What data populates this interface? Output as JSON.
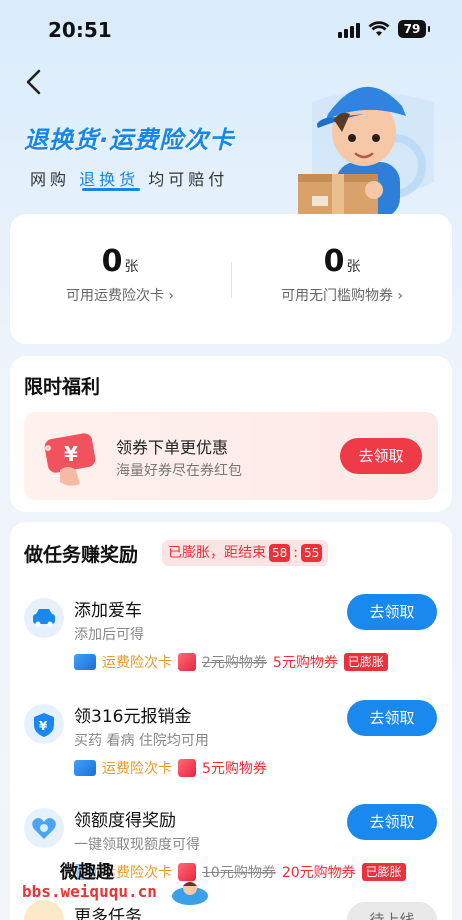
{
  "status_bar": {
    "time": "20:51",
    "battery": "79"
  },
  "hero": {
    "title": "退换货·运费险次卡",
    "subtitle_pre": "网购",
    "subtitle_hl": "退换货",
    "subtitle_post": "均可赔付"
  },
  "stats": [
    {
      "num": "0",
      "unit": "张",
      "label": "可用运费险次卡 ›"
    },
    {
      "num": "0",
      "unit": "张",
      "label": "可用无门槛购物券 ›"
    }
  ],
  "benefits": {
    "title": "限时福利",
    "coupon_title": "领券下单更优惠",
    "coupon_desc": "海量好券尽在券红包",
    "button": "去领取"
  },
  "tasks": {
    "title": "做任务赚奖励",
    "timer_label": "已膨胀，距结束",
    "timer_min": "58",
    "timer_sep": ":",
    "timer_sec": "55",
    "items": [
      {
        "name": "添加爱车",
        "desc": "添加后可得",
        "button": "去领取",
        "reward_card": "运费险次卡",
        "reward_old": "2元购物券",
        "reward_new": "5元购物券",
        "badge": "已膨胀"
      },
      {
        "name": "领316元报销金",
        "desc": "买药 看病 住院均可用",
        "button": "去领取",
        "reward_card": "运费险次卡",
        "reward_new": "5元购物券"
      },
      {
        "name": "领额度得奖励",
        "desc": "一键领取现额度可得",
        "button": "去领取",
        "reward_card": "运费险次卡",
        "reward_old": "10元购物券",
        "reward_new": "20元购物券",
        "badge": "已膨胀"
      }
    ],
    "more_label": "更多任务",
    "more_button": "待上线"
  },
  "watermark": {
    "line1": "微趣趣",
    "line2": "bbs.weiququ.cn"
  },
  "colors": {
    "brand_blue": "#1a89ef",
    "accent_red": "#ee2f3c",
    "card_orange": "#e8992a"
  }
}
